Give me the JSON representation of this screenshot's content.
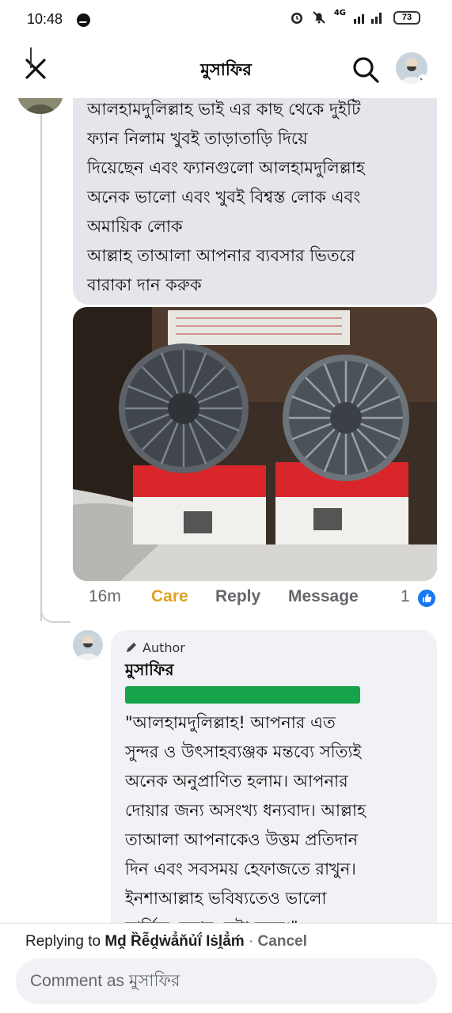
{
  "status_bar": {
    "time": "10:48",
    "network": "4G",
    "battery": "73"
  },
  "header": {
    "title": "মুসাফির",
    "close_icon": "close-icon",
    "search_icon": "search-icon"
  },
  "comment": {
    "lines": [
      "আলহামদুলিল্লাহ ভাই এর কাছ থেকে দুইটি",
      "ফ্যান নিলাম খুবই তাড়াতাড়ি দিয়ে",
      "দিয়েছেন এবং ফ্যানগুলো আলহামদুলিল্লাহ",
      "অনেক ভালো এবং খুবই বিশ্বস্ত লোক এবং",
      "অমায়িক লোক",
      "আল্লাহ তাআলা আপনার ব্যবসার ভিতরে",
      "বারাকা দান করুক"
    ],
    "time": "16m",
    "care_label": "Care",
    "reply_label": "Reply",
    "message_label": "Message",
    "reaction_count": "1"
  },
  "reply": {
    "author_badge": "Author",
    "name": "মুসাফির",
    "lines": [
      "\"আলহামদুলিল্লাহ! আপনার এত",
      "সুন্দর ও উৎসাহব্যঞ্জক মন্তব্যে সত্যিই",
      "অনেক অনুপ্রাণিত হলাম। আপনার",
      "দোয়ার জন্য অসংখ্য ধন্যবাদ। আল্লাহ",
      "তাআলা আপনাকেও উত্তম প্রতিদান",
      "দিন এবং সবসময় হেফাজতে রাখুন।",
      "ইনশাআল্লাহ ভবিষ্যতেও ভালো",
      "সার্ভিস দেয়ার চেষ্টা করব।\""
    ]
  },
  "footer": {
    "replying_prefix": "Replying to",
    "replying_name": "Mḓ Ȑễḓẇẳňủḯ Iṡḽẳḿ",
    "separator": "·",
    "cancel_label": "Cancel",
    "input_placeholder": "Comment as মুসাফির"
  },
  "colors": {
    "care": "#e0a121",
    "like_blue": "#1877f2",
    "bubble": "#e4e6eb",
    "green_bar": "#16a34a"
  }
}
